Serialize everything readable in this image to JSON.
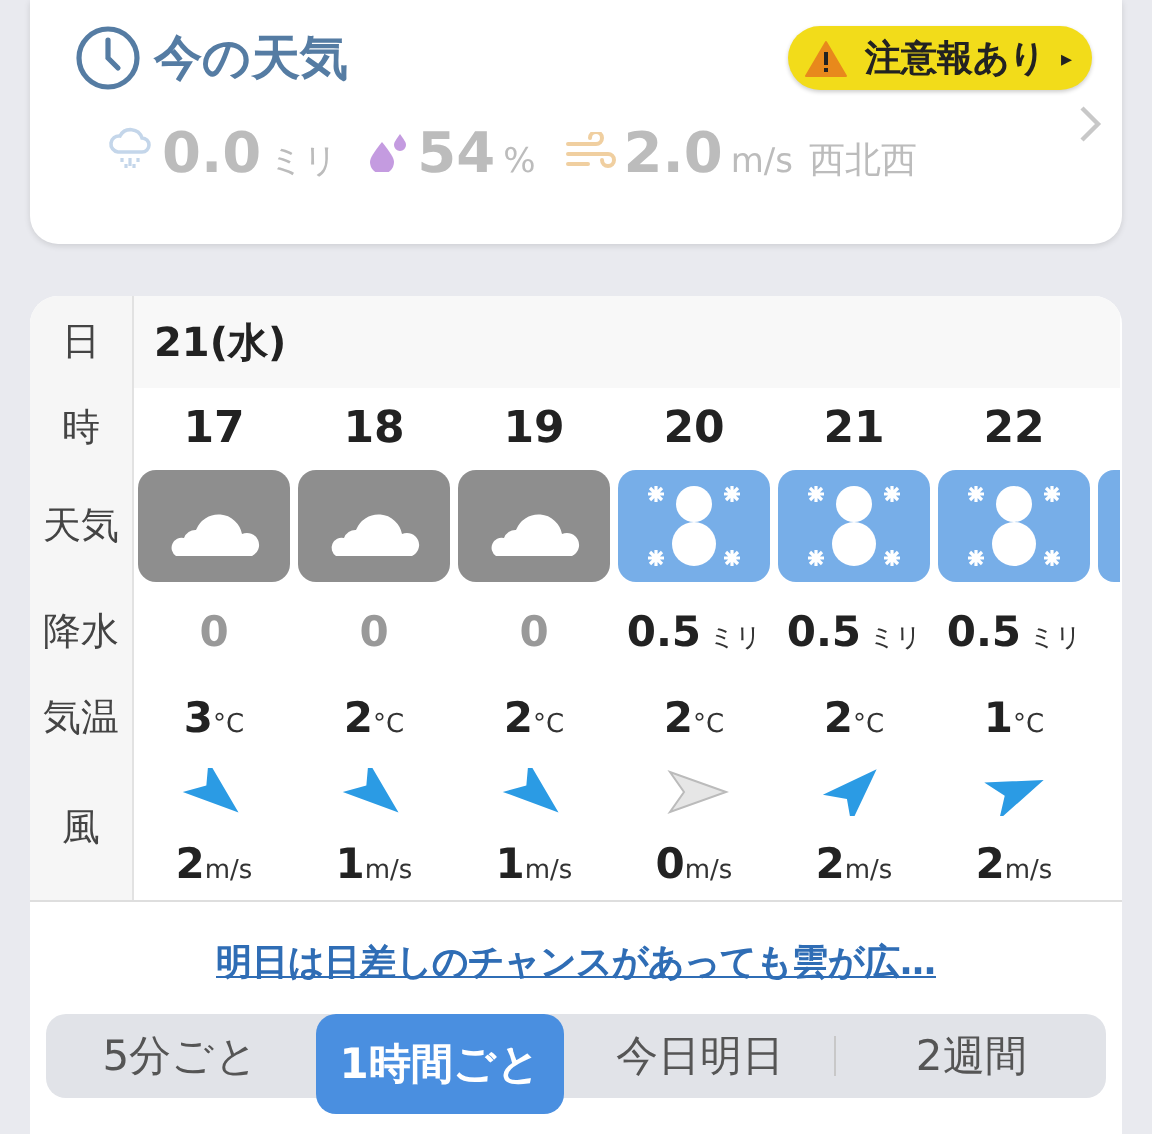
{
  "current": {
    "title": "今の天気",
    "alert": "注意報あり",
    "alert_arrow": "▸",
    "precip_value": "0.0",
    "precip_unit": "ミリ",
    "humidity_value": "54",
    "humidity_unit": "%",
    "wind_value": "2.0",
    "wind_unit": "m/s",
    "wind_direction": "西北西"
  },
  "table": {
    "labels": {
      "date": "日",
      "hour": "時",
      "weather": "天気",
      "precip": "降水",
      "temp": "気温",
      "wind": "風"
    },
    "date": "21(水)",
    "hours": [
      {
        "hour": "17",
        "kind": "cloudy",
        "precip": "0",
        "temp": "3",
        "temp_unit": "°C",
        "wind_arrow": {
          "kind": "southeast",
          "calm": false
        },
        "wind": "2",
        "wind_unit": "m/s"
      },
      {
        "hour": "18",
        "kind": "cloudy",
        "precip": "0",
        "temp": "2",
        "temp_unit": "°C",
        "wind_arrow": {
          "kind": "southeast",
          "calm": false
        },
        "wind": "1",
        "wind_unit": "m/s"
      },
      {
        "hour": "19",
        "kind": "cloudy",
        "precip": "0",
        "temp": "2",
        "temp_unit": "°C",
        "wind_arrow": {
          "kind": "southeast",
          "calm": false
        },
        "wind": "1",
        "wind_unit": "m/s"
      },
      {
        "hour": "20",
        "kind": "snow",
        "precip": "0.5",
        "precip_unit": "ミリ",
        "temp": "2",
        "temp_unit": "°C",
        "wind_arrow": {
          "kind": "east",
          "calm": true
        },
        "wind": "0",
        "wind_unit": "m/s"
      },
      {
        "hour": "21",
        "kind": "snow",
        "precip": "0.5",
        "precip_unit": "ミリ",
        "temp": "2",
        "temp_unit": "°C",
        "wind_arrow": {
          "kind": "northeast",
          "calm": false
        },
        "wind": "2",
        "wind_unit": "m/s"
      },
      {
        "hour": "22",
        "kind": "snow",
        "precip": "0.5",
        "precip_unit": "ミリ",
        "temp": "1",
        "temp_unit": "°C",
        "wind_arrow": {
          "kind": "eastnortheast",
          "calm": false
        },
        "wind": "2",
        "wind_unit": "m/s"
      },
      {
        "kind": "snow"
      }
    ]
  },
  "forecast_link": "明日は日差しのチャンスがあっても雲が広…",
  "tabs": [
    {
      "label": "5分ごと",
      "selected": false
    },
    {
      "label": "1時間ごと",
      "selected": true
    },
    {
      "label": "今日明日",
      "selected": false
    },
    {
      "label": "2週間",
      "selected": false
    }
  ]
}
